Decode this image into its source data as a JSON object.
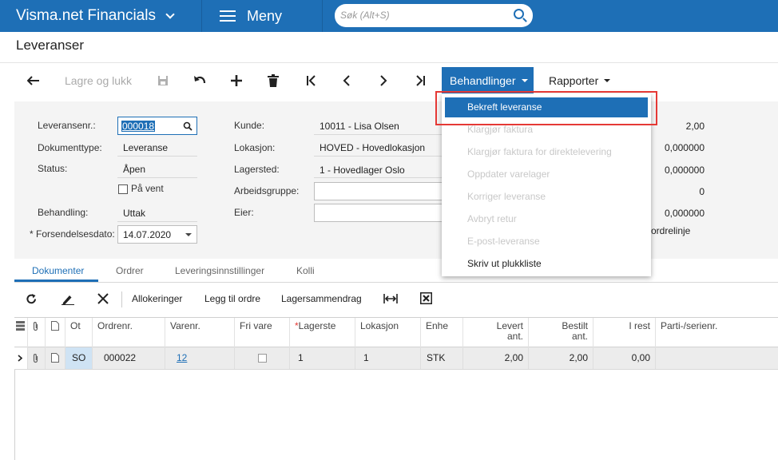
{
  "app": {
    "name": "Visma.net Financials",
    "menu_label": "Meny",
    "search_placeholder": "Søk (Alt+S)"
  },
  "page": {
    "title": "Leveranser"
  },
  "toolbar": {
    "save_close": "Lagre og lukk",
    "actions_label": "Behandlinger",
    "reports_label": "Rapporter"
  },
  "actions_menu": {
    "items": [
      {
        "label": "Bekreft leveranse",
        "enabled": true,
        "selected": true
      },
      {
        "label": "Klargjør faktura",
        "enabled": false
      },
      {
        "label": "Klargjør faktura for direktelevering",
        "enabled": false
      },
      {
        "label": "Oppdater varelager",
        "enabled": false
      },
      {
        "label": "Korriger leveranse",
        "enabled": false
      },
      {
        "label": "Avbryt retur",
        "enabled": false
      },
      {
        "label": "E-post-leveranse",
        "enabled": false
      },
      {
        "label": "Skriv ut plukkliste",
        "enabled": true
      }
    ]
  },
  "form": {
    "shipment_nbr_label": "Leveransenr.:",
    "shipment_nbr": "000018",
    "doc_type_label": "Dokumenttype:",
    "doc_type": "Leveranse",
    "status_label": "Status:",
    "status": "Åpen",
    "on_hold_label": "På vent",
    "operation_label": "Behandling:",
    "operation": "Uttak",
    "ship_date_label": "Forsendelsesdato:",
    "ship_date": "14.07.2020",
    "required_marker": "*",
    "customer_label": "Kunde:",
    "customer": "10011 - Lisa Olsen",
    "location_label": "Lokasjon:",
    "location": "HOVED - Hovedlokasjon",
    "warehouse_label": "Lagersted:",
    "warehouse": "1 - Hovedlager Oslo",
    "workgroup_label": "Arbeidsgruppe:",
    "owner_label": "Eier:",
    "right_values": [
      "2,00",
      "0,000000",
      "0,000000",
      "0",
      "0,000000"
    ],
    "right_partial": "ordrelinje"
  },
  "tabs": [
    {
      "label": "Dokumenter",
      "active": true
    },
    {
      "label": "Ordrer",
      "active": false
    },
    {
      "label": "Leveringsinnstillinger",
      "active": false
    },
    {
      "label": "Kolli",
      "active": false
    }
  ],
  "grid_toolbar": {
    "allocations": "Allokeringer",
    "add_order": "Legg til ordre",
    "inventory_summary": "Lagersammendrag"
  },
  "grid": {
    "headers": {
      "order_type": "Ot",
      "order_nbr": "Ordrenr.",
      "item_nbr": "Varenr.",
      "free_item": "Fri vare",
      "warehouse_required": "*",
      "warehouse": "Lagerste",
      "location": "Lokasjon",
      "uom": "Enhe",
      "shipped_qty_1": "Levert",
      "shipped_qty_2": "ant.",
      "ordered_qty_1": "Bestilt",
      "ordered_qty_2": "ant.",
      "open_qty": "I rest",
      "lot_serial": "Parti-/serienr."
    },
    "rows": [
      {
        "order_type": "SO",
        "order_nbr": "000022",
        "item_nbr": "12",
        "free_item": false,
        "warehouse": "1",
        "location": "1",
        "uom": "STK",
        "shipped_qty": "2,00",
        "ordered_qty": "2,00",
        "open_qty": "0,00",
        "lot_serial": ""
      }
    ]
  },
  "colors": {
    "brand": "#1e6fb6",
    "highlight": "#e53935"
  }
}
